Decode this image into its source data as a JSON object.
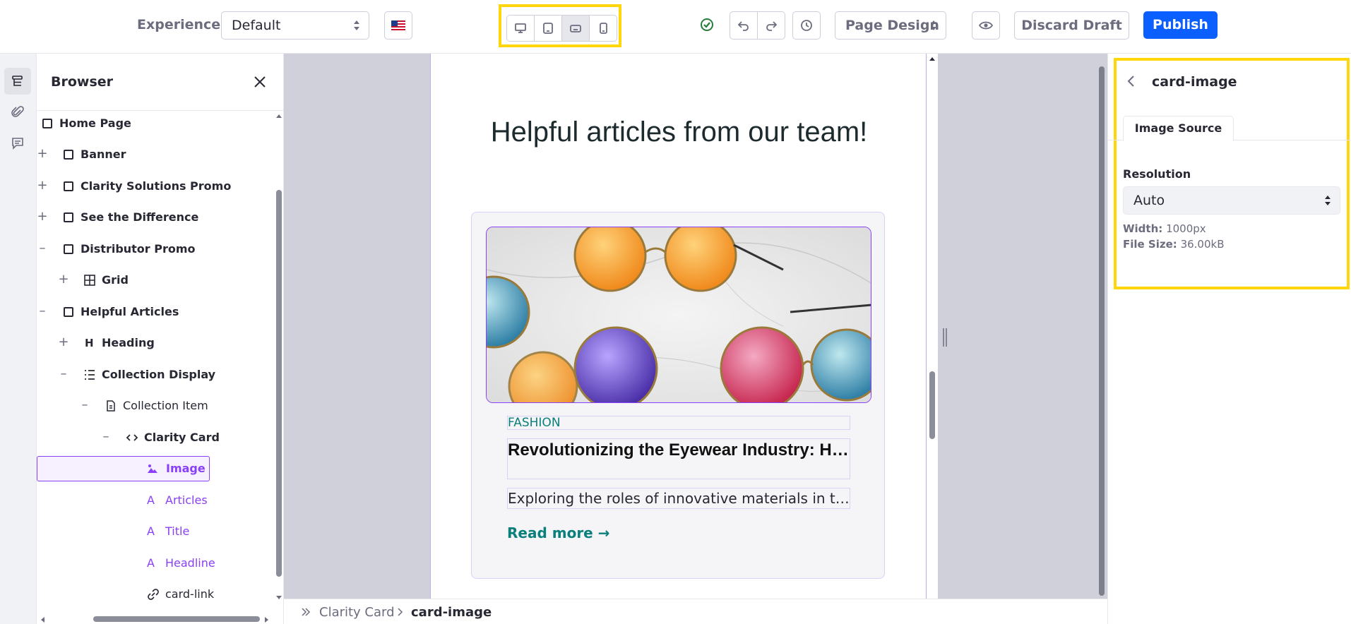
{
  "toolbar": {
    "experience_label": "Experience",
    "experience_value": "Default",
    "language_flag": "us-flag-icon",
    "devices": [
      {
        "name": "desktop",
        "icon": "desktop-icon",
        "active": false
      },
      {
        "name": "tablet",
        "icon": "tablet-icon",
        "active": false
      },
      {
        "name": "landscape-phone",
        "icon": "landscape-phone-icon",
        "active": true
      },
      {
        "name": "portrait-phone",
        "icon": "portrait-phone-icon",
        "active": false
      }
    ],
    "status_icon": "check-circle-icon",
    "undo_icon": "undo-icon",
    "redo_icon": "redo-icon",
    "history_icon": "history-icon",
    "mode_value": "Page Design",
    "preview_icon": "eye-icon",
    "discard_label": "Discard Draft",
    "publish_label": "Publish"
  },
  "rail": {
    "items": [
      {
        "icon": "page-structure-icon",
        "active": true
      },
      {
        "icon": "paperclip-icon",
        "active": false
      },
      {
        "icon": "comments-icon",
        "active": false
      }
    ]
  },
  "browser": {
    "title": "Browser",
    "tree": [
      {
        "label": "Home Page"
      },
      {
        "label": "Banner"
      },
      {
        "label": "Clarity Solutions Promo"
      },
      {
        "label": "See the Difference"
      },
      {
        "label": "Distributor Promo"
      },
      {
        "label": "Grid"
      },
      {
        "label": "Helpful Articles"
      },
      {
        "label": "Heading"
      },
      {
        "label": "Collection Display"
      },
      {
        "label": "Collection Item"
      },
      {
        "label": "Clarity Card"
      },
      {
        "label": "Image"
      },
      {
        "label": "Articles"
      },
      {
        "label": "Title"
      },
      {
        "label": "Headline"
      },
      {
        "label": "card-link"
      }
    ]
  },
  "canvas": {
    "heading": "Helpful articles from our team!",
    "card": {
      "category": "FASHION",
      "title": "Revolutionizing the Eyewear Industry: How...",
      "description": "Exploring the roles of innovative materials in tra...",
      "link": "Read more →"
    }
  },
  "breadcrumb": {
    "items": [
      "Clarity Card",
      "card-image"
    ]
  },
  "config_panel": {
    "title": "card-image",
    "tab": "Image Source",
    "resolution_label": "Resolution",
    "resolution_value": "Auto",
    "width_label": "Width:",
    "width_value": "1000px",
    "filesize_label": "File Size:",
    "filesize_value": "36.00kB"
  },
  "colors": {
    "primary": "#0b5fff",
    "highlight": "#ffd60a",
    "selection": "#8a3ff8",
    "accent_teal": "#0b7f7b"
  }
}
